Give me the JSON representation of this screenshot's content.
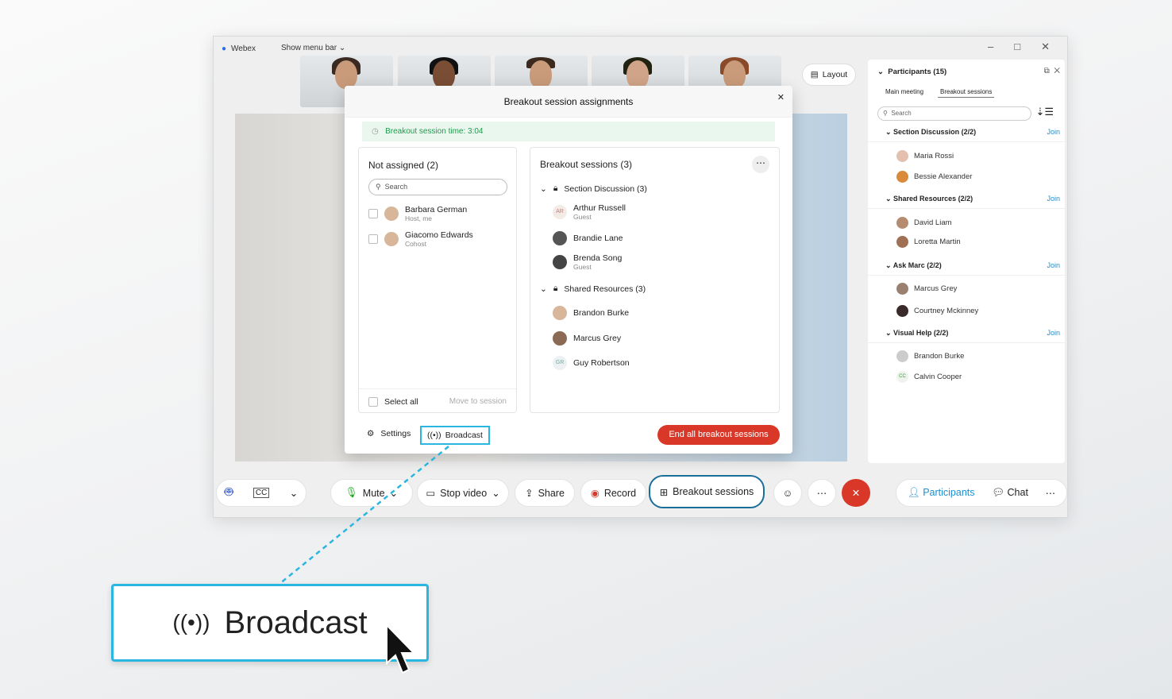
{
  "titlebar": {
    "app": "Webex",
    "menu": "Show menu bar"
  },
  "layout_btn": "Layout",
  "modal": {
    "title": "Breakout session assignments",
    "timer": "Breakout session time: 3:04",
    "not_assigned": {
      "title": "Not assigned (2)",
      "search": "Search",
      "people": [
        {
          "name": "Barbara German",
          "role": "Host, me"
        },
        {
          "name": "Giacomo Edwards",
          "role": "Cohost"
        }
      ],
      "select_all": "Select all",
      "move": "Move to session"
    },
    "sessions": {
      "title": "Breakout sessions (3)",
      "groups": [
        {
          "name": "Section Discussion (3)",
          "people": [
            {
              "name": "Arthur Russell",
              "role": "Guest",
              "initials": "AR"
            },
            {
              "name": "Brandie Lane",
              "role": ""
            },
            {
              "name": "Brenda Song",
              "role": "Guest"
            }
          ]
        },
        {
          "name": "Shared Resources (3)",
          "people": [
            {
              "name": "Brandon Burke",
              "role": ""
            },
            {
              "name": "Marcus Grey",
              "role": ""
            },
            {
              "name": "Guy Robertson",
              "role": "",
              "initials": "GR"
            }
          ]
        }
      ]
    },
    "settings": "Settings",
    "broadcast": "Broadcast",
    "end_all": "End all breakout sessions"
  },
  "participants": {
    "title": "Participants (15)",
    "tabs": [
      "Main meeting",
      "Breakout sessions"
    ],
    "search": "Search",
    "join": "Join",
    "groups": [
      {
        "name": "Section Discussion (2/2)",
        "people": [
          "Maria Rossi",
          "Bessie Alexander"
        ]
      },
      {
        "name": "Shared Resources (2/2)",
        "people": [
          "David Liam",
          "Loretta Martin"
        ]
      },
      {
        "name": "Ask Marc (2/2)",
        "people": [
          "Marcus Grey",
          "Courtney Mckinney"
        ]
      },
      {
        "name": "Visual Help (2/2)",
        "people": [
          "Brandon Burke",
          "Calvin Cooper"
        ]
      }
    ],
    "calvin_initials": "CC"
  },
  "controls": {
    "mute": "Mute",
    "stop_video": "Stop video",
    "share": "Share",
    "record": "Record",
    "breakout": "Breakout sessions",
    "participants": "Participants",
    "chat": "Chat"
  },
  "callout": {
    "label": "Broadcast"
  },
  "colors": {
    "accent": "#1b8fcf",
    "end": "#d93829",
    "callout": "#29b6e0",
    "timer_bg": "#eaf7ef",
    "timer_text": "#1f9a4c"
  }
}
